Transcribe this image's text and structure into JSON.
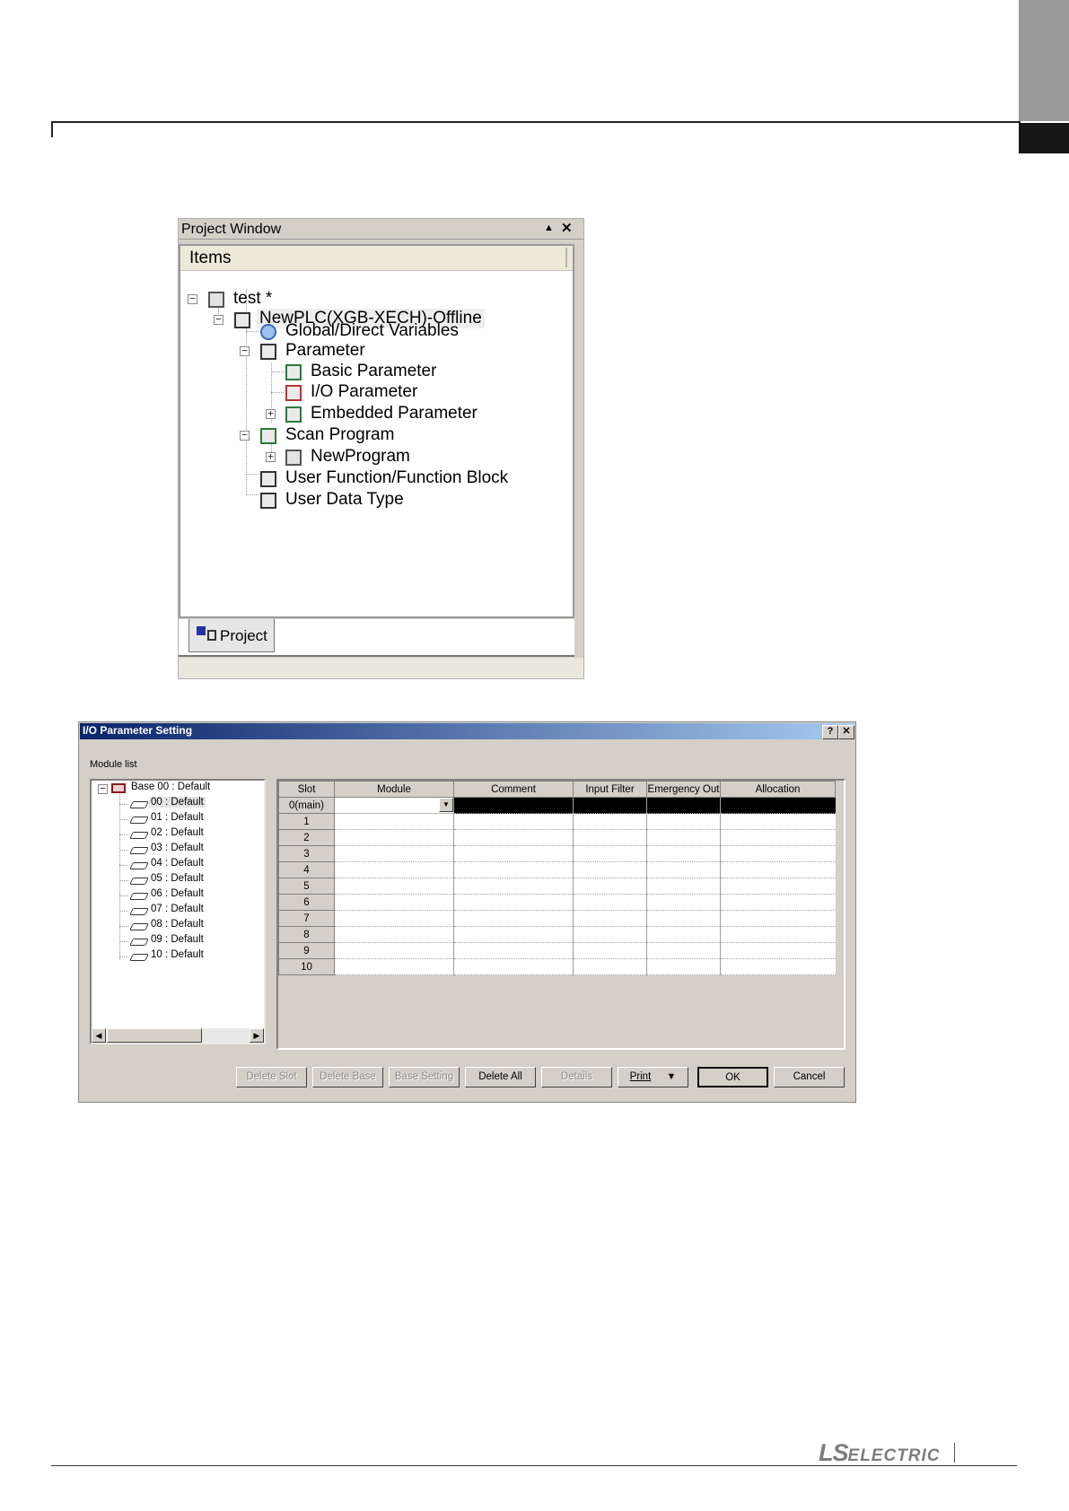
{
  "project_window": {
    "title": "Project Window",
    "pin_glyph": "▲",
    "close_glyph": "✕",
    "header": "Items",
    "tree": {
      "root": "test *",
      "plc": "NewPLC(XGB-XECH)-Offline",
      "global_vars": "Global/Direct Variables",
      "parameter": "Parameter",
      "basic_param": "Basic Parameter",
      "io_param": "I/O Parameter",
      "embedded_param": "Embedded Parameter",
      "scan_program": "Scan Program",
      "new_program": "NewProgram",
      "user_function": "User Function/Function Block",
      "user_data_type": "User Data Type"
    },
    "tab_label": "Project"
  },
  "io_dialog": {
    "title": "I/O Parameter Setting",
    "help_glyph": "?",
    "close_glyph": "✕",
    "module_list_label": "Module list",
    "base_label": "Base 00 : Default",
    "slots": [
      "00 : Default",
      "01 : Default",
      "02 : Default",
      "03 : Default",
      "04 : Default",
      "05 : Default",
      "06 : Default",
      "07 : Default",
      "08 : Default",
      "09 : Default",
      "10 : Default"
    ],
    "columns": [
      "Slot",
      "Module",
      "Comment",
      "Input Filter",
      "Emergency Out",
      "Allocation"
    ],
    "rows": [
      "0(main)",
      "1",
      "2",
      "3",
      "4",
      "5",
      "6",
      "7",
      "8",
      "9",
      "10"
    ],
    "buttons": {
      "delete_slot": "Delete Slot",
      "delete_base": "Delete Base",
      "base_setting": "Base Setting",
      "delete_all": "Delete All",
      "details": "Details",
      "print": "Print",
      "ok": "OK",
      "cancel": "Cancel"
    }
  },
  "footer": {
    "logo_ls": "LS",
    "logo_electric": "ELECTRIC"
  }
}
